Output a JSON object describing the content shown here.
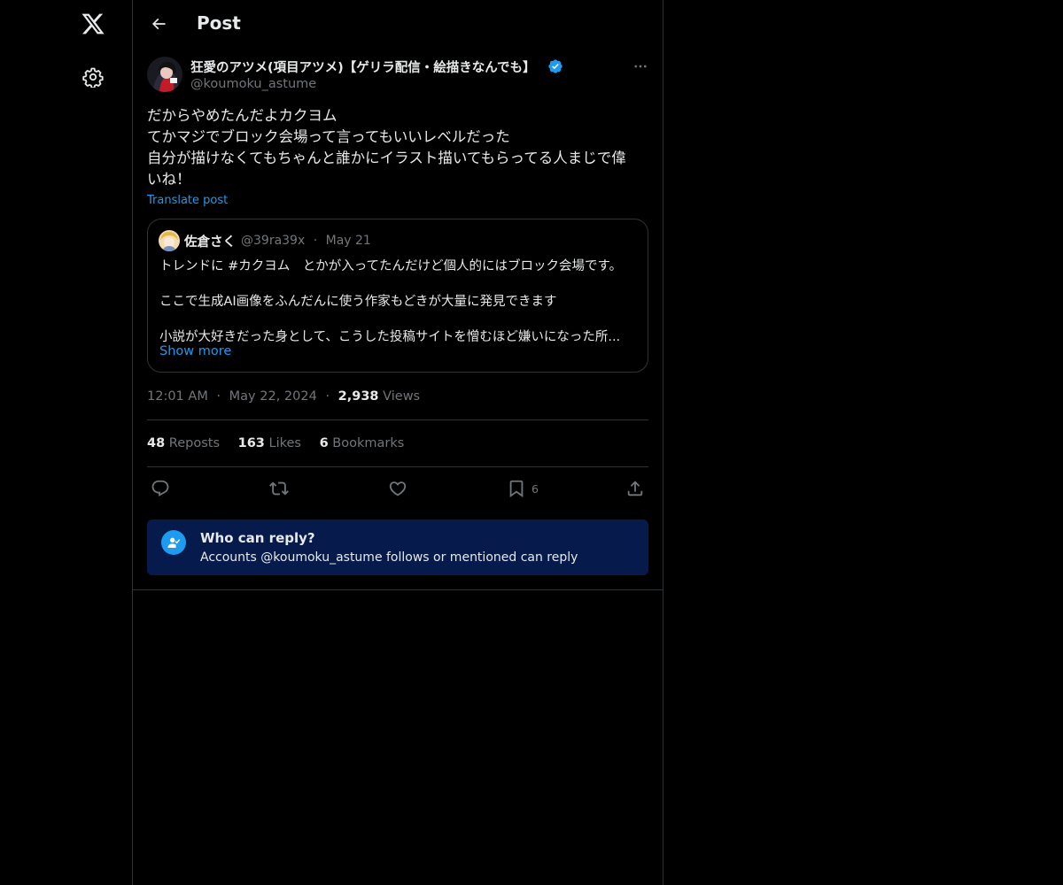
{
  "rail": {
    "logo_icon": "x-logo-icon",
    "settings_icon": "gear-icon"
  },
  "header": {
    "title": "Post",
    "back_icon": "arrow-left-icon"
  },
  "post": {
    "author_name": "狂愛のアツメ(項目アツメ)【ゲリラ配信・絵描きなんでも】",
    "author_handle": "@koumoku_astume",
    "verified": true,
    "text_lines": [
      "だからやめたんだよカクヨム",
      "てかマジでブロック会場って言ってもいいレベルだった",
      "自分が描けなくてもちゃんと誰かにイラスト描いてもらってる人まじで偉",
      "いね！"
    ],
    "translate_label": "Translate post",
    "time": "12:01 AM",
    "date": "May 22, 2024",
    "views_count": "2,938",
    "views_label": "Views",
    "separator": "·"
  },
  "quote": {
    "name": "佐倉さく",
    "handle": "@39ra39x",
    "date": "May 21",
    "line1": "トレンドに #カクヨム　とかが入ってたんだけど個人的にはブロック会場です。",
    "line2": "ここで生成AI画像をふんだんに使う作家もどきが大量に発見できます",
    "line3": "小説が大好きだった身として、こうした投稿サイトを憎むほど嫌いになった所...",
    "show_more": "Show more"
  },
  "stats": {
    "reposts_count": "48",
    "reposts_label": "Reposts",
    "likes_count": "163",
    "likes_label": "Likes",
    "bookmarks_count": "6",
    "bookmarks_label": "Bookmarks"
  },
  "actions": {
    "reply_icon": "reply-icon",
    "repost_icon": "repost-icon",
    "like_icon": "heart-icon",
    "bookmark_icon": "bookmark-icon",
    "bookmark_count": "6",
    "share_icon": "share-icon"
  },
  "who_can_reply": {
    "title": "Who can reply?",
    "description": "Accounts @koumoku_astume follows or mentioned can reply"
  },
  "colors": {
    "background": "#000000",
    "text": "#e7e9ea",
    "secondary": "#71767b",
    "accent": "#1d9bf0",
    "border": "#2f3336",
    "reply_box": "#061a4b"
  }
}
